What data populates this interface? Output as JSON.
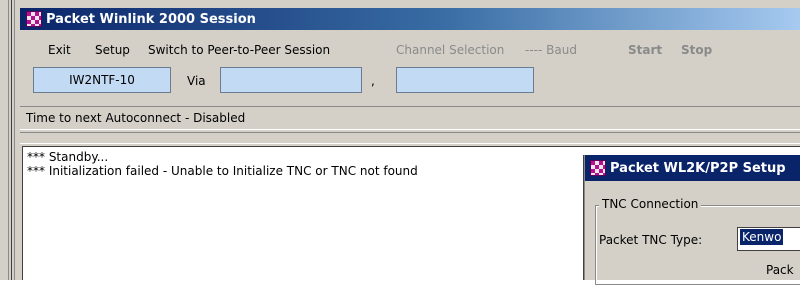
{
  "window": {
    "title": "Packet Winlink 2000 Session"
  },
  "menu": [
    {
      "label": "Exit",
      "enabled": true
    },
    {
      "label": "Setup",
      "enabled": true
    },
    {
      "label": "Switch to Peer-to-Peer Session",
      "enabled": true
    },
    {
      "label": "Channel Selection",
      "enabled": false
    },
    {
      "label": "---- Baud",
      "enabled": false
    },
    {
      "label": "Start",
      "enabled": false
    },
    {
      "label": "Stop",
      "enabled": false
    }
  ],
  "connection": {
    "callsign": "IW2NTF-10",
    "via_label": "Via",
    "via_value": "",
    "separator": ",",
    "via_value2": ""
  },
  "status": {
    "autoconnect_text": "Time to next Autoconnect - Disabled"
  },
  "log": [
    "*** Standby...",
    "*** Initialization failed - Unable to Initialize TNC or TNC not found"
  ],
  "dialog": {
    "title": "Packet WL2K/P2P Setup",
    "group_label": "TNC Connection",
    "tnc_type_label": "Packet TNC Type:",
    "tnc_type_value": "Kenwo",
    "partial_label": "Pack"
  },
  "colors": {
    "title_bar": "#0a246a",
    "input_bg": "#c3daf5",
    "window_bg": "#d4d0c8",
    "disabled_text": "#8a8a8a"
  },
  "icons": {
    "app": "checkered-app-icon"
  }
}
